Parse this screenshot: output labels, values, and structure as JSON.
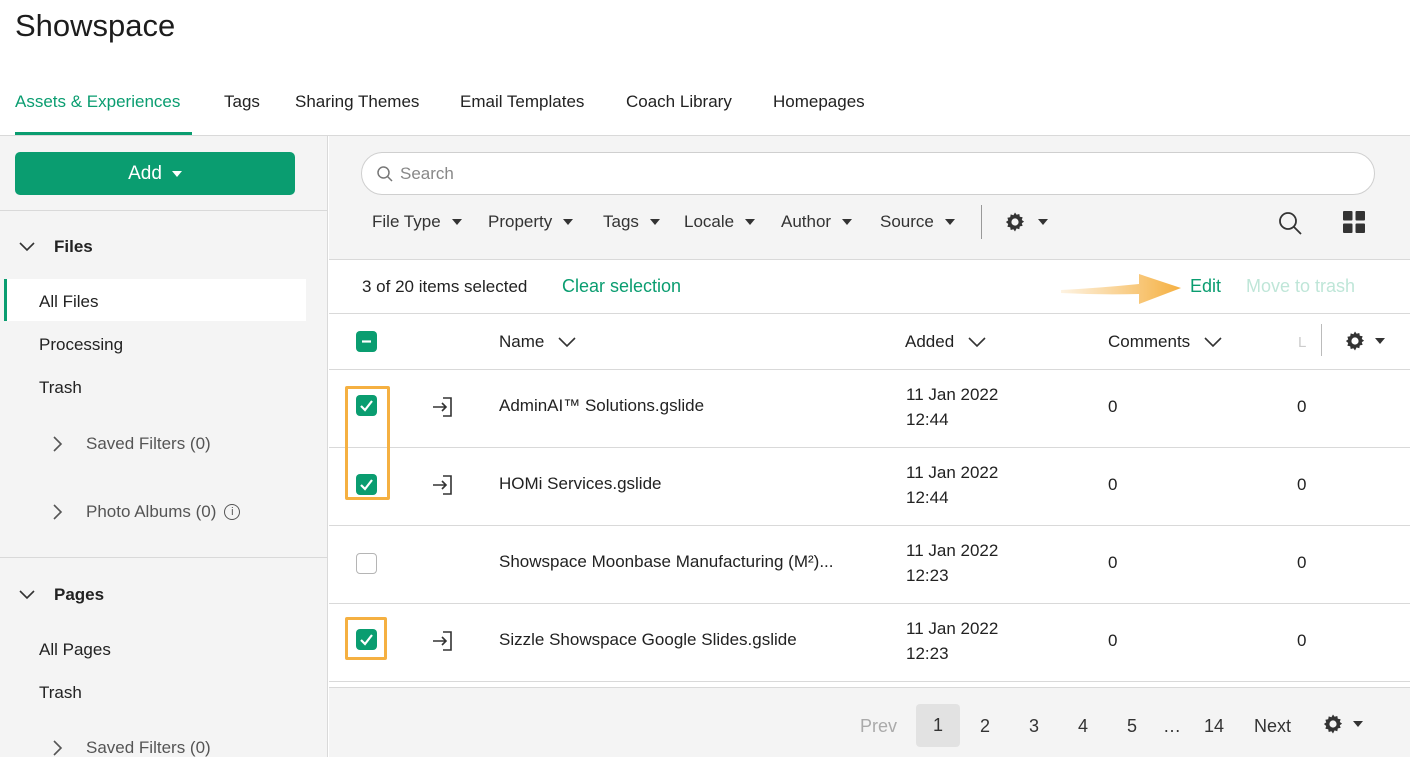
{
  "app": {
    "title": "Showspace"
  },
  "tabs": [
    {
      "label": "Assets & Experiences",
      "active": true
    },
    {
      "label": "Tags"
    },
    {
      "label": "Sharing Themes"
    },
    {
      "label": "Email Templates"
    },
    {
      "label": "Coach Library"
    },
    {
      "label": "Homepages"
    }
  ],
  "sidebar": {
    "add_label": "Add",
    "files": {
      "heading": "Files",
      "items": [
        "All Files",
        "Processing",
        "Trash"
      ],
      "active": "All Files",
      "saved_filters": "Saved Filters (0)",
      "photo_albums": "Photo Albums (0)"
    },
    "pages": {
      "heading": "Pages",
      "items": [
        "All Pages",
        "Trash"
      ],
      "saved_filters": "Saved Filters (0)"
    }
  },
  "toolbar": {
    "search_placeholder": "Search",
    "filters": [
      "File Type",
      "Property",
      "Tags",
      "Locale",
      "Author",
      "Source"
    ]
  },
  "selection": {
    "count_text": "3 of 20 items selected",
    "clear_label": "Clear selection",
    "edit_label": "Edit",
    "trash_label": "Move to trash"
  },
  "table": {
    "columns": {
      "name": "Name",
      "added": "Added",
      "comments": "Comments",
      "l": "L"
    },
    "rows": [
      {
        "name": "AdminAI™ Solutions.gslide",
        "date": "11 Jan 2022",
        "time": "12:44",
        "comments": "0",
        "l": "0",
        "checked": true
      },
      {
        "name": "HOMi Services.gslide",
        "date": "11 Jan 2022",
        "time": "12:44",
        "comments": "0",
        "l": "0",
        "checked": true
      },
      {
        "name": "Showspace Moonbase Manufacturing (M²)...",
        "date": "11 Jan 2022",
        "time": "12:23",
        "comments": "0",
        "l": "0",
        "checked": false
      },
      {
        "name": "Sizzle Showspace Google Slides.gslide",
        "date": "11 Jan 2022",
        "time": "12:23",
        "comments": "0",
        "l": "0",
        "checked": true
      }
    ]
  },
  "pagination": {
    "prev": "Prev",
    "pages": [
      "1",
      "2",
      "3",
      "4",
      "5"
    ],
    "ellipsis": "…",
    "last": "14",
    "next": "Next",
    "current": "1"
  },
  "colors": {
    "accent": "#0a9d70",
    "highlight": "#f5b041",
    "panel": "#f4f4f4"
  }
}
